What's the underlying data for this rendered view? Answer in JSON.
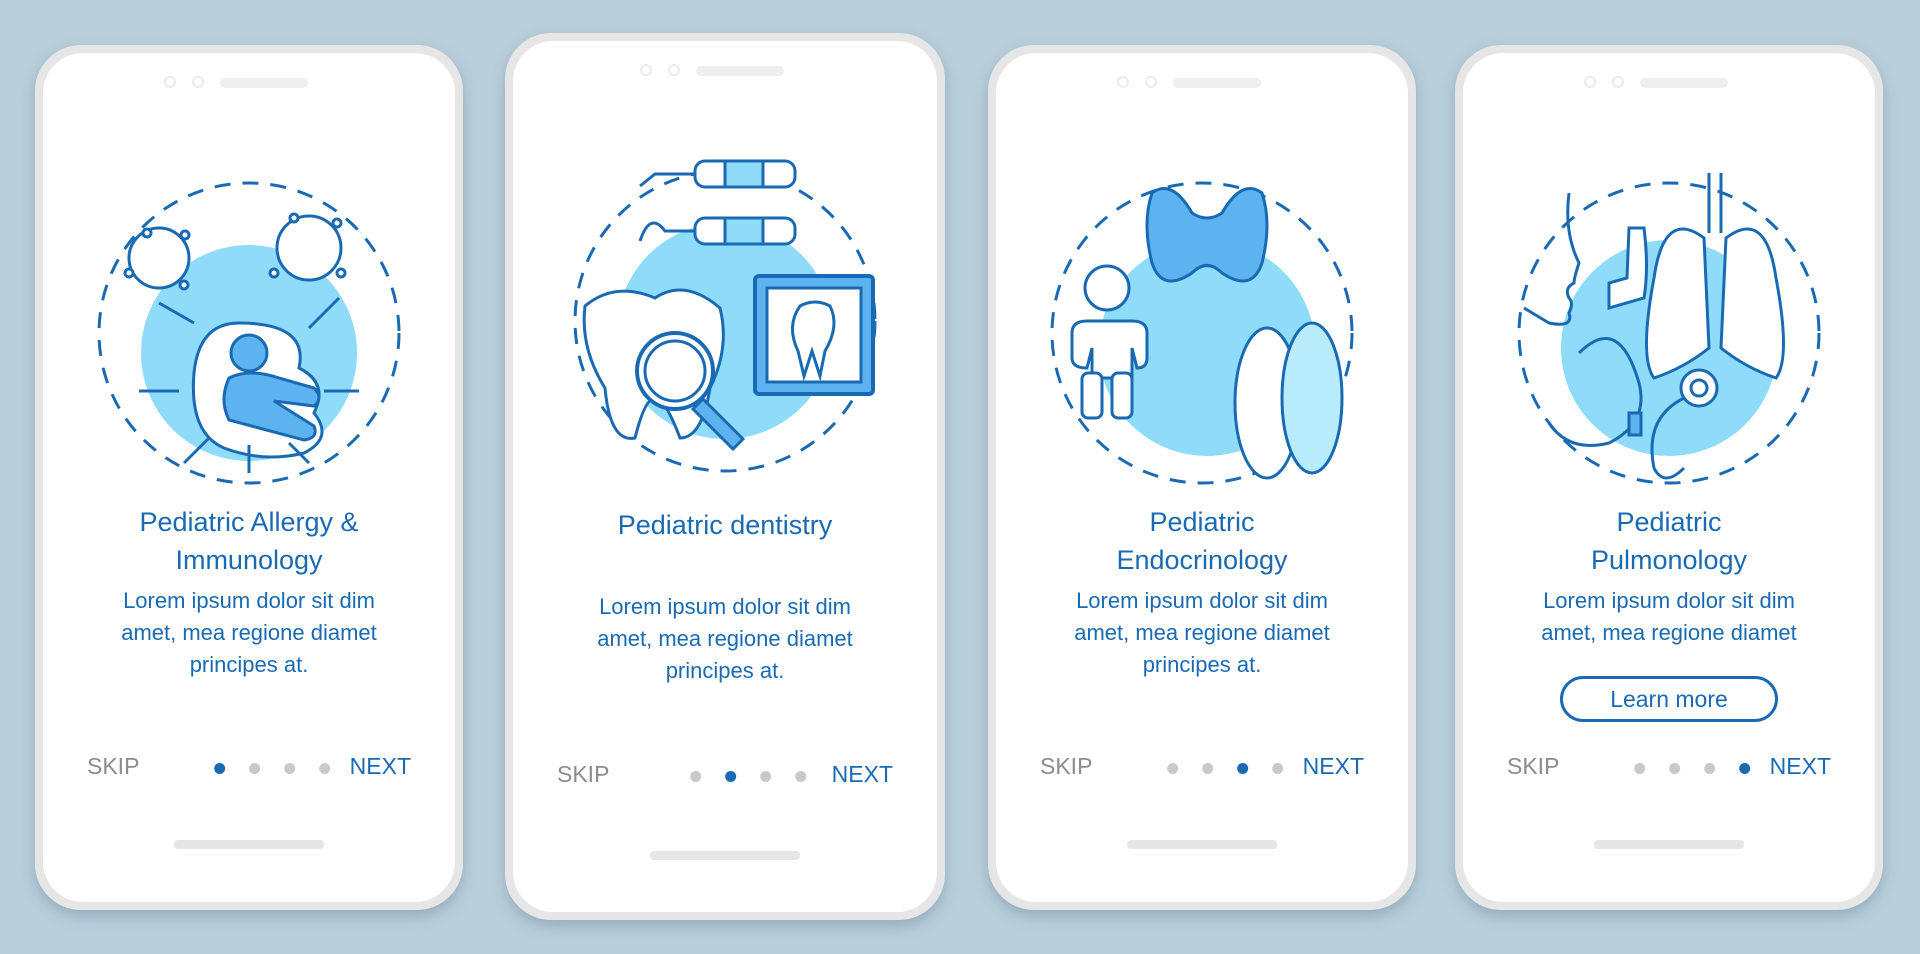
{
  "theme": {
    "accent": "#1a6ab3",
    "light_blue": "#8fdcfa",
    "fill_blue": "#5db3f0",
    "inactive_dot": "#c9c9c9",
    "skip_gray": "#8c8c8c",
    "background": "#b9cfdb"
  },
  "screens": [
    {
      "illustration": "allergy-immunology-illustration",
      "title_lines": [
        "Pediatric Allergy &",
        "Immunology"
      ],
      "description_lines": [
        "Lorem ipsum dolor sit dim",
        "amet, mea regione diamet",
        "principes at."
      ],
      "skip_label": "SKIP",
      "next_label": "NEXT",
      "active_page": 1,
      "total_pages": 4
    },
    {
      "illustration": "dentistry-illustration",
      "title_lines": [
        "Pediatric dentistry"
      ],
      "description_lines": [
        "Lorem ipsum dolor sit dim",
        "amet, mea regione diamet",
        "principes at."
      ],
      "skip_label": "SKIP",
      "next_label": "NEXT",
      "active_page": 2,
      "total_pages": 4
    },
    {
      "illustration": "endocrinology-illustration",
      "title_lines": [
        "Pediatric",
        "Endocrinology"
      ],
      "description_lines": [
        "Lorem ipsum dolor sit dim",
        "amet, mea regione diamet",
        "principes at."
      ],
      "skip_label": "SKIP",
      "next_label": "NEXT",
      "active_page": 3,
      "total_pages": 4
    },
    {
      "illustration": "pulmonology-illustration",
      "title_lines": [
        "Pediatric",
        "Pulmonology"
      ],
      "description_lines": [
        "Lorem ipsum dolor sit dim",
        "amet, mea regione diamet"
      ],
      "button_label": "Learn more",
      "skip_label": "SKIP",
      "next_label": "NEXT",
      "active_page": 4,
      "total_pages": 4
    }
  ]
}
